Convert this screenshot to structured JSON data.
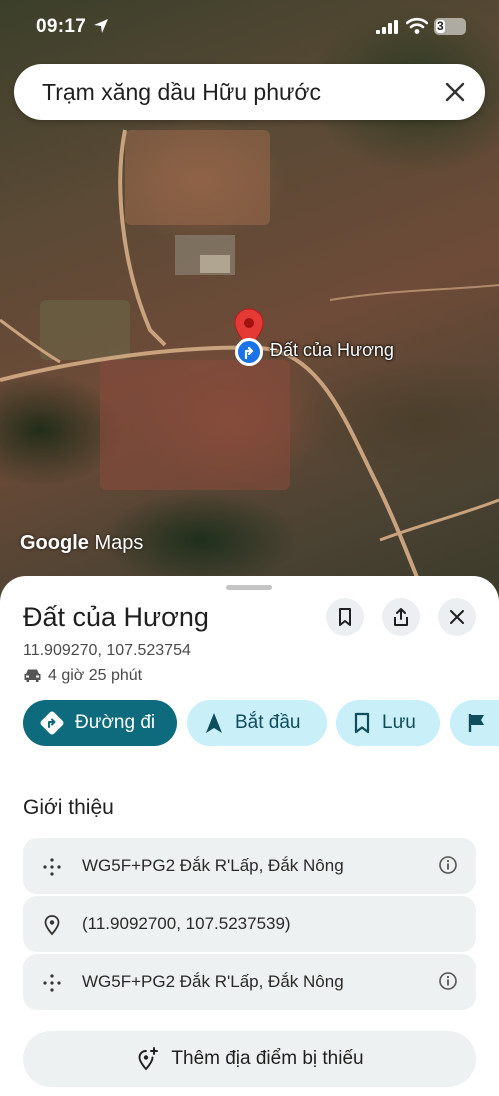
{
  "status_bar": {
    "time": "09:17",
    "battery": "3"
  },
  "search": {
    "query": "Trạm xăng dầu Hữu phước"
  },
  "map": {
    "pin_label": "Đất của Hương",
    "attribution_bold": "Google",
    "attribution_rest": " Maps"
  },
  "place": {
    "title": "Đất của Hương",
    "coordinates": "11.909270, 107.523754",
    "drive_time": "4 giờ 25 phút"
  },
  "actions": {
    "directions": "Đường đi",
    "start": "Bắt đầu",
    "save": "Lưu"
  },
  "about": {
    "heading": "Giới thiệu",
    "rows": [
      {
        "text": "WG5F+PG2 Đắk R'Lấp, Đắk Nông"
      },
      {
        "text": "(11.9092700, 107.5237539)"
      },
      {
        "text": "WG5F+PG2 Đắk R'Lấp, Đắk Nông"
      }
    ],
    "add_missing": "Thêm địa điểm bị thiếu"
  },
  "colors": {
    "primary": "#0e6b7d",
    "secondary": "#c9eff8",
    "pin": "#e53935",
    "location_dot": "#1a73e8"
  }
}
